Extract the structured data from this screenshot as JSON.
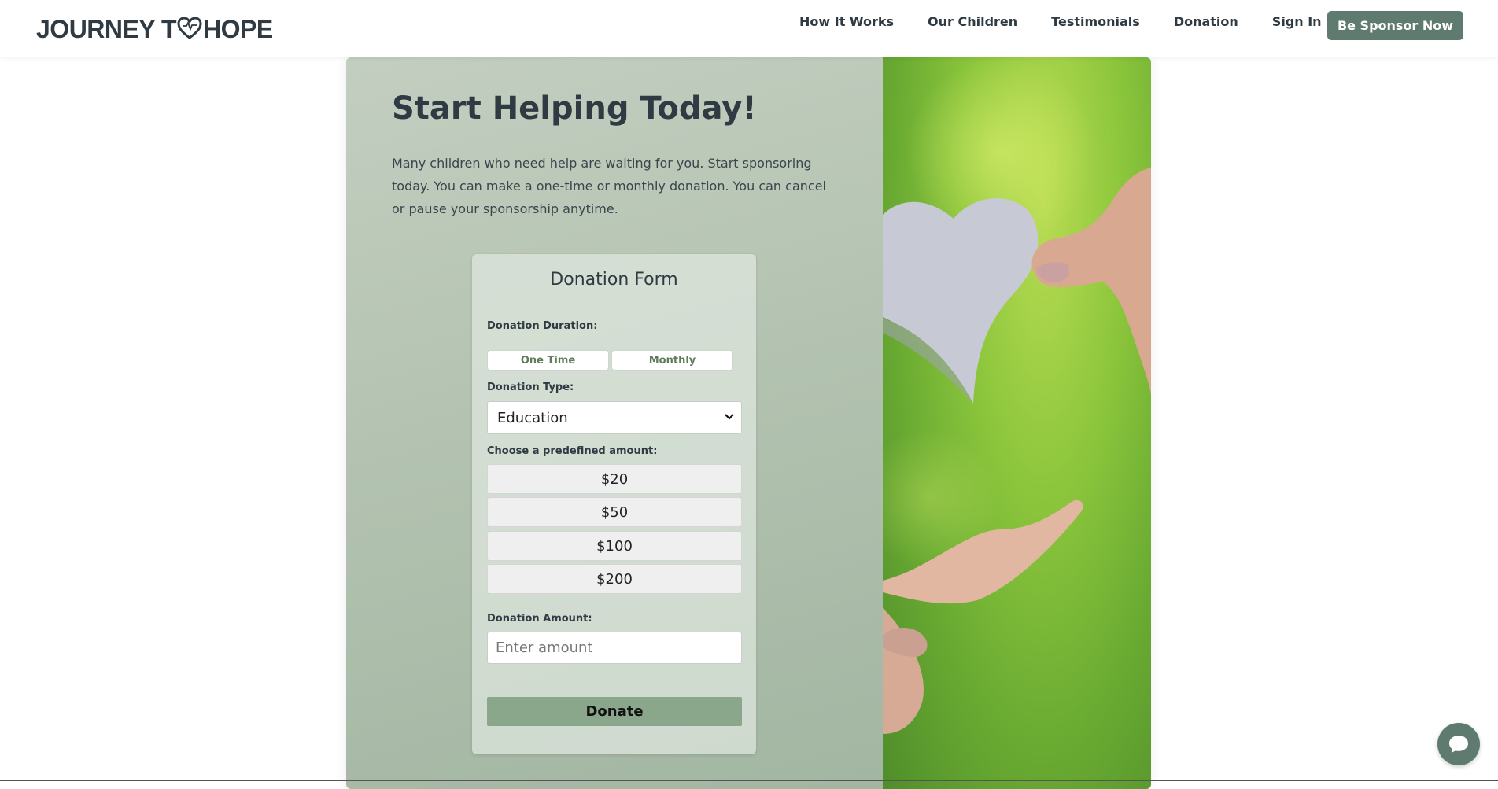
{
  "brand": {
    "logo_left": "JOURNEY T",
    "logo_right": "HOPE",
    "accent": "#5f7b70"
  },
  "nav": {
    "items": [
      {
        "label": "How It Works"
      },
      {
        "label": "Our Children"
      },
      {
        "label": "Testimonials"
      },
      {
        "label": "Donation"
      },
      {
        "label": "Sign In"
      }
    ],
    "cta_label": "Be Sponsor Now"
  },
  "hero": {
    "title": "Start Helping Today!",
    "text": "Many children who need help are waiting for you. Start sponsoring today. You can make a one-time or monthly donation. You can cancel or pause your sponsorship anytime.",
    "image_icon": "hands-heart-photo"
  },
  "form": {
    "title": "Donation Form",
    "duration_label": "Donation Duration:",
    "duration_options": [
      "One Time",
      "Monthly"
    ],
    "type_label": "Donation Type:",
    "type_selected": "Education",
    "predefined_label": "Choose a predefined amount:",
    "predefined_amounts": [
      "$20",
      "$50",
      "$100",
      "$200"
    ],
    "amount_label": "Donation Amount:",
    "amount_placeholder": "Enter amount",
    "submit_label": "Donate"
  },
  "chat": {
    "icon": "chat-bubble-icon"
  }
}
